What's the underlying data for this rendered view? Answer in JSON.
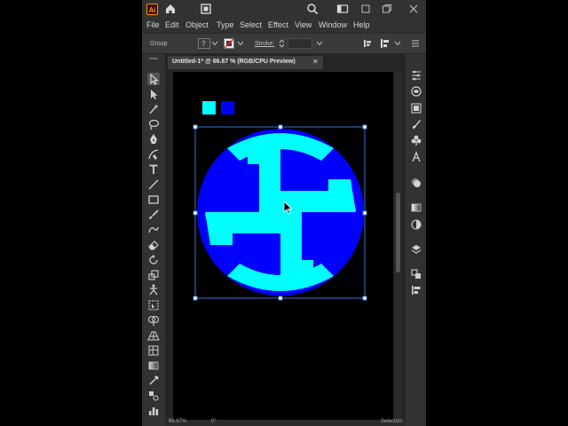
{
  "app": {
    "logo": "Ai"
  },
  "titlebar": {
    "icons": [
      "home-icon",
      "document-icon",
      "search-icon",
      "workspace-icon",
      "minimize-icon",
      "restore-icon",
      "close-icon"
    ]
  },
  "menubar": {
    "items": [
      "File",
      "Edit",
      "Object",
      "Type",
      "Select",
      "Effect",
      "View",
      "Window",
      "Help"
    ]
  },
  "control": {
    "selection_label": "Group",
    "stroke_label": "Stroke:"
  },
  "document": {
    "tab_title": "Untitled-1* @ 66.67 % (RGB/CPU Preview)",
    "close_glyph": "✕"
  },
  "status": {
    "zoom": "66.67%",
    "rotation": "0°",
    "tool": "Selection"
  },
  "colors": {
    "cyan": "#00ffff",
    "blue": "#0000ff",
    "selection": "#4a90ff",
    "artboard": "#000000",
    "ui": "#323232"
  },
  "toolbar": {
    "tools": [
      "selection-tool",
      "direct-selection-tool",
      "magic-wand-tool",
      "lasso-tool",
      "pen-tool",
      "curvature-tool",
      "type-tool",
      "line-tool",
      "rectangle-tool",
      "paintbrush-tool",
      "shaper-tool",
      "eraser-tool",
      "rotate-tool",
      "scale-tool",
      "puppet-warp-tool",
      "free-transform-tool",
      "shape-builder-tool",
      "perspective-grid-tool",
      "mesh-tool",
      "gradient-tool",
      "eyedropper-tool",
      "blend-tool",
      "symbol-sprayer-tool",
      "column-graph-tool"
    ]
  },
  "panels": {
    "icons": [
      "properties-icon",
      "libraries-icon",
      "color-icon",
      "brushes-icon",
      "symbols-icon",
      "type-icon",
      "appearance-icon",
      "gradient-icon",
      "transparency-icon",
      "layers-icon",
      "artboards-icon",
      "align-icon"
    ]
  }
}
